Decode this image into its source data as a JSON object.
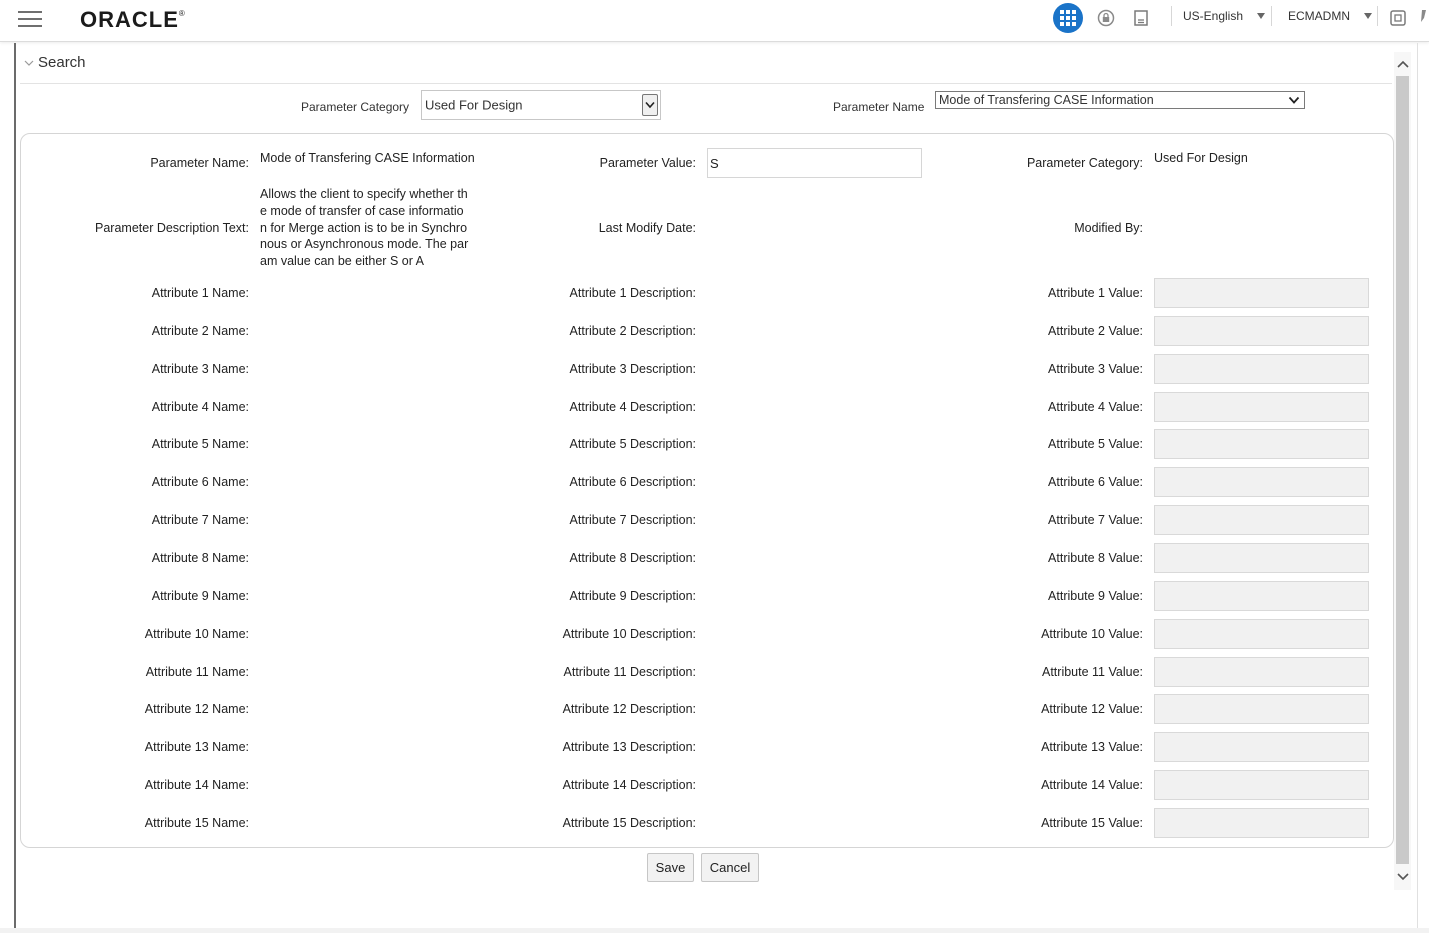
{
  "header": {
    "logo": "ORACLE",
    "logo_mark": "®",
    "language": "US-English",
    "user": "ECMADMN",
    "accent_color": "#1a73c8"
  },
  "search": {
    "title": "Search",
    "parameter_category_label": "Parameter Category",
    "parameter_category_value": "Used For Design",
    "parameter_name_label": "Parameter Name",
    "parameter_name_value": "Mode of Transfering CASE Information"
  },
  "detail": {
    "parameter_name_label": "Parameter Name:",
    "parameter_name_value": "Mode of Transfering CASE Information",
    "parameter_value_label": "Parameter Value:",
    "parameter_value": "S",
    "parameter_category_label": "Parameter Category:",
    "parameter_category_value": "Used For Design",
    "description_label": "Parameter Description Text:",
    "description_text": "Allows the client to specify whether th\ne mode of transfer of case informatio\nn for Merge action is to be in Synchro\nnous or Asynchronous mode. The par\nam value can be either S or A",
    "last_modify_label": "Last Modify Date:",
    "modified_by_label": "Modified By:",
    "attributes": [
      {
        "name_label": "Attribute 1 Name:",
        "desc_label": "Attribute 1 Description:",
        "value_label": "Attribute 1 Value:"
      },
      {
        "name_label": "Attribute 2 Name:",
        "desc_label": "Attribute 2 Description:",
        "value_label": "Attribute 2 Value:"
      },
      {
        "name_label": "Attribute 3 Name:",
        "desc_label": "Attribute 3 Description:",
        "value_label": "Attribute 3 Value:"
      },
      {
        "name_label": "Attribute 4 Name:",
        "desc_label": "Attribute 4 Description:",
        "value_label": "Attribute 4 Value:"
      },
      {
        "name_label": "Attribute 5 Name:",
        "desc_label": "Attribute 5 Description:",
        "value_label": "Attribute 5 Value:"
      },
      {
        "name_label": "Attribute 6 Name:",
        "desc_label": "Attribute 6 Description:",
        "value_label": "Attribute 6 Value:"
      },
      {
        "name_label": "Attribute 7 Name:",
        "desc_label": "Attribute 7 Description:",
        "value_label": "Attribute 7 Value:"
      },
      {
        "name_label": "Attribute 8 Name:",
        "desc_label": "Attribute 8 Description:",
        "value_label": "Attribute 8 Value:"
      },
      {
        "name_label": "Attribute 9 Name:",
        "desc_label": "Attribute 9 Description:",
        "value_label": "Attribute 9 Value:"
      },
      {
        "name_label": "Attribute 10 Name:",
        "desc_label": "Attribute 10 Description:",
        "value_label": "Attribute 10 Value:"
      },
      {
        "name_label": "Attribute 11 Name:",
        "desc_label": "Attribute 11 Description:",
        "value_label": "Attribute 11 Value:"
      },
      {
        "name_label": "Attribute 12 Name:",
        "desc_label": "Attribute 12 Description:",
        "value_label": "Attribute 12 Value:"
      },
      {
        "name_label": "Attribute 13 Name:",
        "desc_label": "Attribute 13 Description:",
        "value_label": "Attribute 13 Value:"
      },
      {
        "name_label": "Attribute 14 Name:",
        "desc_label": "Attribute 14 Description:",
        "value_label": "Attribute 14 Value:"
      },
      {
        "name_label": "Attribute 15 Name:",
        "desc_label": "Attribute 15 Description:",
        "value_label": "Attribute 15 Value:"
      }
    ]
  },
  "actions": {
    "save_label": "Save",
    "cancel_label": "Cancel"
  }
}
